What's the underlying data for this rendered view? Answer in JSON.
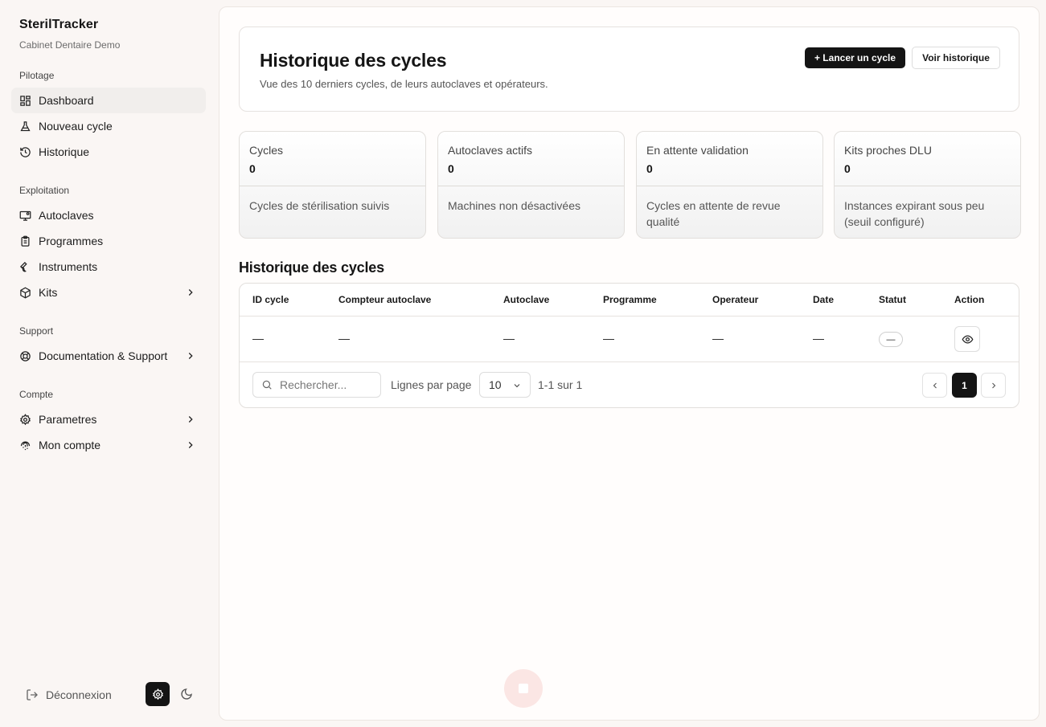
{
  "brand": {
    "name": "SterilTracker",
    "subtitle": "Cabinet Dentaire Demo"
  },
  "sidebar": {
    "groups": [
      {
        "title": "Pilotage",
        "items": [
          {
            "label": "Dashboard",
            "icon": "dashboard-icon",
            "active": true
          },
          {
            "label": "Nouveau cycle",
            "icon": "flask-icon"
          },
          {
            "label": "Historique",
            "icon": "history-icon"
          }
        ]
      },
      {
        "title": "Exploitation",
        "items": [
          {
            "label": "Autoclaves",
            "icon": "monitor-icon"
          },
          {
            "label": "Programmes",
            "icon": "clipboard-icon"
          },
          {
            "label": "Instruments",
            "icon": "wrench-icon"
          },
          {
            "label": "Kits",
            "icon": "package-icon",
            "has_submenu": true
          }
        ]
      },
      {
        "title": "Support",
        "items": [
          {
            "label": "Documentation & Support",
            "icon": "lifebuoy-icon",
            "has_submenu": true
          }
        ]
      },
      {
        "title": "Compte",
        "items": [
          {
            "label": "Parametres",
            "icon": "gear-icon",
            "has_submenu": true
          },
          {
            "label": "Mon compte",
            "icon": "fingerprint-icon",
            "has_submenu": true
          }
        ]
      }
    ],
    "footer": {
      "logout_label": "Déconnexion"
    }
  },
  "hero": {
    "title": "Historique des cycles",
    "subtitle": "Vue des 10 derniers cycles, de leurs autoclaves et opérateurs.",
    "primary_button": "+ Lancer un cycle",
    "secondary_button": "Voir historique"
  },
  "stats": [
    {
      "label": "Cycles",
      "value": "0",
      "description": "Cycles de stérilisation suivis"
    },
    {
      "label": "Autoclaves actifs",
      "value": "0",
      "description": "Machines non désactivées"
    },
    {
      "label": "En attente validation",
      "value": "0",
      "description": "Cycles en attente de revue qualité"
    },
    {
      "label": "Kits proches DLU",
      "value": "0",
      "description": "Instances expirant sous peu (seuil configuré)"
    }
  ],
  "table": {
    "title": "Historique des cycles",
    "columns": [
      "ID cycle",
      "Compteur autoclave",
      "Autoclave",
      "Programme",
      "Operateur",
      "Date",
      "Statut",
      "Action"
    ],
    "rows": [
      {
        "id": "—",
        "counter": "—",
        "autoclave": "—",
        "program": "—",
        "operator": "—",
        "date": "—",
        "status": "—"
      }
    ],
    "search_placeholder": "Rechercher...",
    "rows_per_page_label": "Lignes par page",
    "rows_per_page_value": "10",
    "range_text": "1-1 sur 1",
    "current_page": "1"
  },
  "colors": {
    "primary": "#141414",
    "background": "#faf6f4",
    "floating_button": "#fbe6e4"
  }
}
